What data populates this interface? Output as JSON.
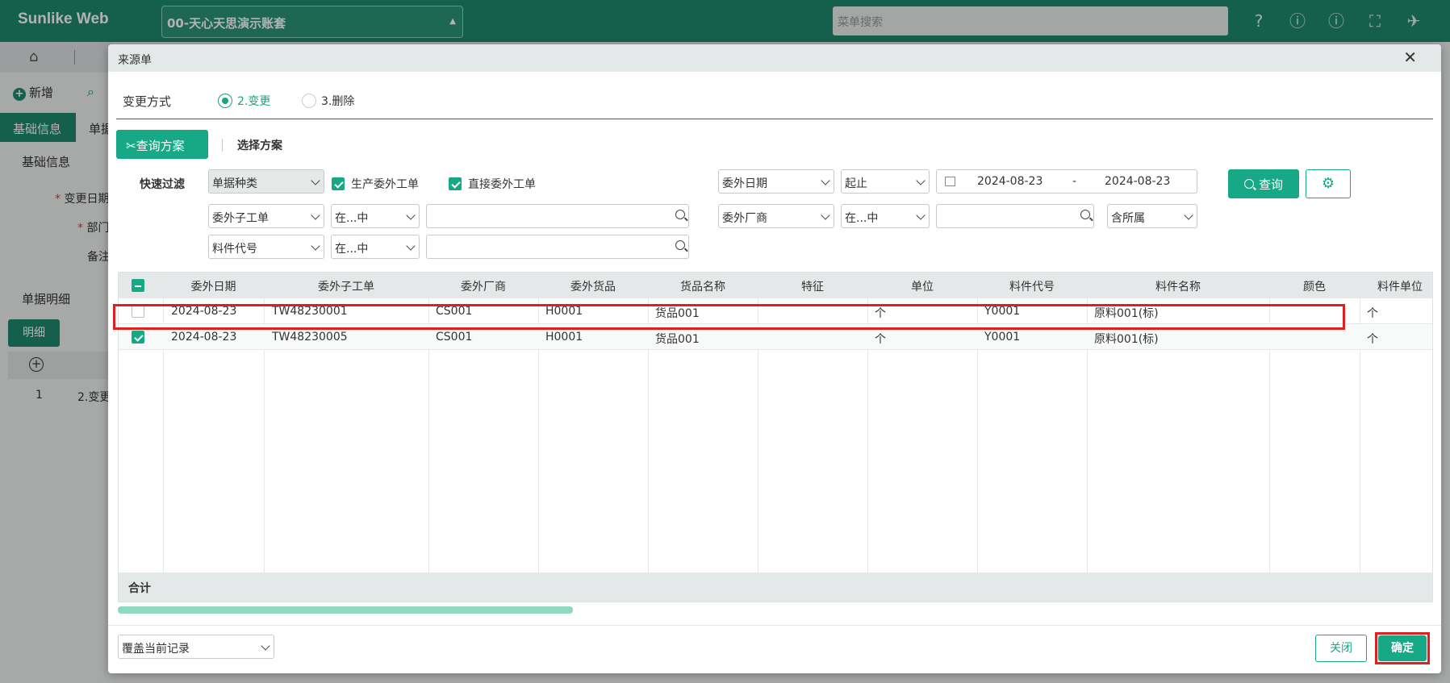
{
  "app": {
    "brand": "Sunlike Web",
    "account": "00-天心天思演示账套",
    "menu_search_placeholder": "菜单搜索",
    "top_icons": [
      "help-icon",
      "info-icon",
      "info-icon",
      "fullscreen-icon",
      "bird-icon"
    ]
  },
  "background": {
    "toolbar_add": "新增",
    "tab_active": "基础信息",
    "tab_second": "单据",
    "section_basic": "基础信息",
    "field_change_date": "变更日期",
    "field_dept": "部门",
    "field_note": "备注",
    "section_detail": "单据明细",
    "detail_button": "明细",
    "row_no": "1",
    "row_value": "2.变更"
  },
  "modal": {
    "title": "来源单",
    "change_mode_label": "变更方式",
    "change_options": [
      {
        "label": "2.变更",
        "selected": true
      },
      {
        "label": "3.删除",
        "selected": false
      }
    ],
    "query_scheme_button": "查询方案",
    "select_scheme": "选择方案",
    "quick_filter_label": "快速过滤",
    "filters": {
      "doc_type": "单据种类",
      "chk_production": {
        "label": "生产委外工单",
        "checked": true
      },
      "chk_direct": {
        "label": "直接委外工单",
        "checked": true
      },
      "date_field": "委外日期",
      "date_op": "起止",
      "date_from": "2024-08-23",
      "date_sep": "-",
      "date_to": "2024-08-23",
      "sub_order_field": "委外子工单",
      "sub_order_op": "在...中",
      "vendor_field": "委外厂商",
      "vendor_op": "在...中",
      "vendor_scope": "含所属",
      "material_field": "料件代号",
      "material_op": "在...中",
      "query_button": "查询"
    },
    "grid": {
      "columns": [
        "委外日期",
        "委外子工单",
        "委外厂商",
        "委外货品",
        "货品名称",
        "特征",
        "单位",
        "料件代号",
        "料件名称",
        "颜色",
        "料件单位"
      ],
      "rows": [
        {
          "checked": false,
          "cells": [
            "2024-08-23",
            "TW48230001",
            "CS001",
            "H0001",
            "货品001",
            "",
            "个",
            "Y0001",
            "原料001(标)",
            "",
            "个"
          ]
        },
        {
          "checked": true,
          "cells": [
            "2024-08-23",
            "TW48230005",
            "CS001",
            "H0001",
            "货品001",
            "",
            "个",
            "Y0001",
            "原料001(标)",
            "",
            "个"
          ]
        }
      ],
      "footer": "合计"
    },
    "cover_select": "覆盖当前记录",
    "close_button": "关闭",
    "ok_button": "确定",
    "accent_color": "#17a886",
    "highlight_color": "#e02020"
  }
}
